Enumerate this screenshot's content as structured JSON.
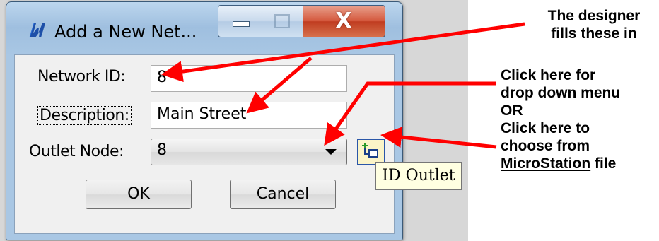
{
  "window": {
    "title": "Add a New Net...",
    "close_glyph": "X"
  },
  "form": {
    "network_id_label": "Network ID:",
    "network_id_value": "8",
    "description_label": "Description:",
    "description_value": "Main Street",
    "outlet_node_label": "Outlet Node:",
    "outlet_node_value": "8",
    "ok_label": "OK",
    "cancel_label": "Cancel",
    "tooltip": "ID Outlet"
  },
  "annotations": {
    "designer_line1": "The designer",
    "designer_line2": "fills these in",
    "click_line1": "Click here for",
    "click_line2": "drop down menu",
    "click_line3": "OR",
    "click_line4": "Click here to",
    "click_line5": "choose from",
    "click_line6_underlined": "MicroStation",
    "click_line6_rest": " file"
  },
  "colors": {
    "arrow": "#ff0000",
    "tooltip_bg": "#ffffe1",
    "close_button": "#c8452a"
  },
  "icons": [
    "app-icon",
    "minimize-icon",
    "maximize-icon",
    "close-icon",
    "dropdown-arrow-icon",
    "id-outlet-icon"
  ]
}
